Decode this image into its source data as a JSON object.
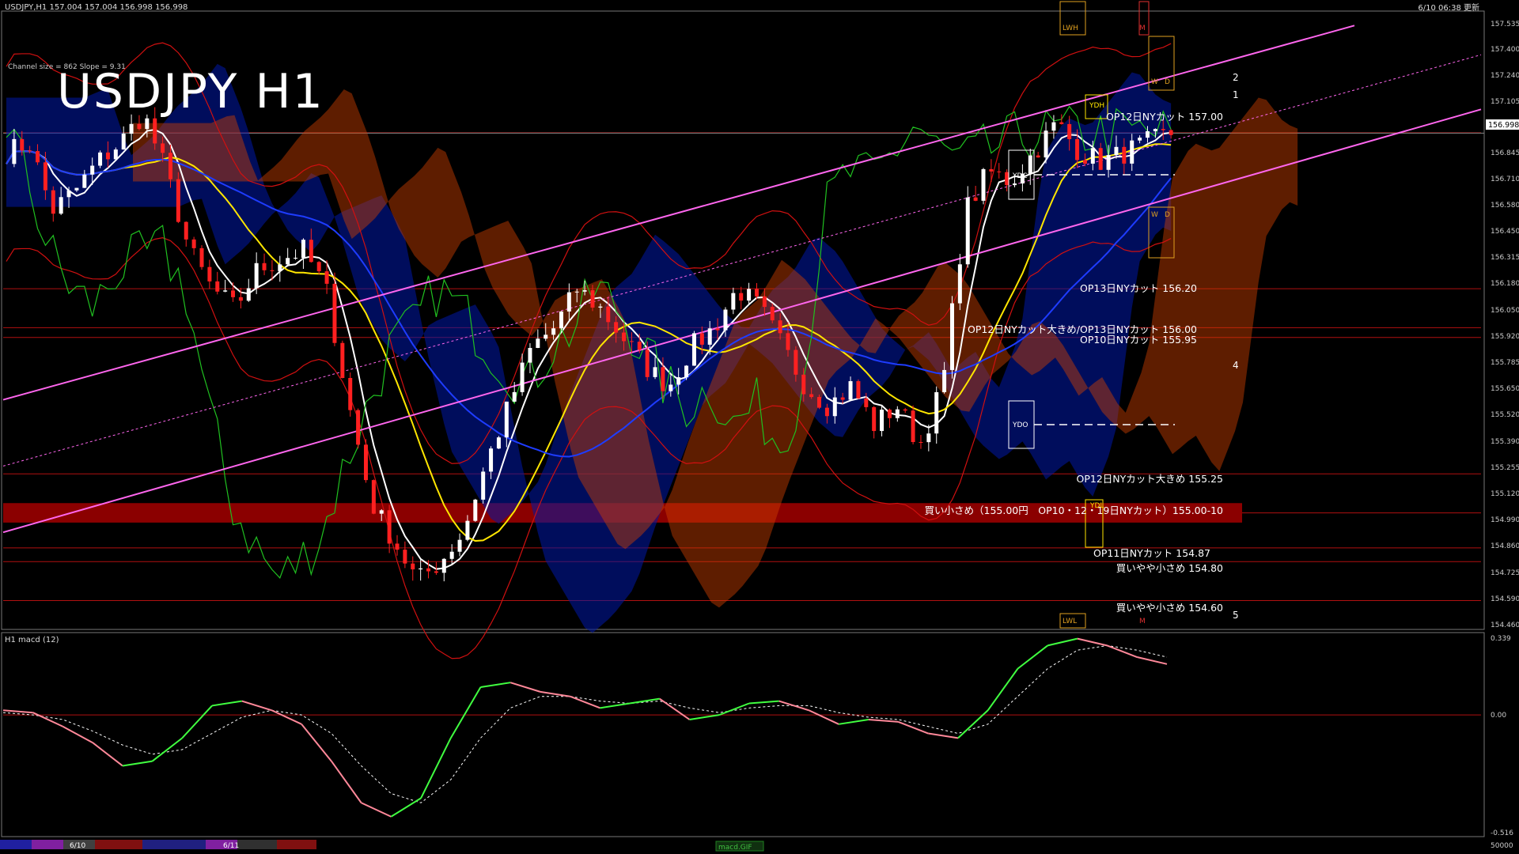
{
  "header": {
    "symbol_line": "USDJPY,H1  157.004 157.004 156.998 156.998",
    "updated": "6/10 06:38 更新",
    "big_title": "USDJPY H1",
    "channel_info": "Channel size = 862 Slope = 9.31"
  },
  "macd_panel": {
    "label": "H1 macd (12)",
    "tab_label": "macd.GIF"
  },
  "price_axis": {
    "ticks": [
      "157.535",
      "157.400",
      "157.240",
      "157.105",
      "156.975",
      "156.845",
      "156.710",
      "156.580",
      "156.450",
      "156.315",
      "156.180",
      "156.050",
      "155.920",
      "155.785",
      "155.650",
      "155.520",
      "155.390",
      "155.255",
      "155.120",
      "154.990",
      "154.860",
      "154.725",
      "154.590",
      "154.460"
    ],
    "current": "156.998"
  },
  "macd_axis": {
    "ticks": [
      "0.339",
      "0.00",
      "-0.516",
      "50000"
    ]
  },
  "date_tabs": [
    "6/10",
    "6/11"
  ],
  "zone_labels": [
    "LWH",
    "M",
    "W",
    "D",
    "YDH",
    "YDC",
    "W",
    "D",
    "YDO",
    "YDL",
    "LWL",
    "M"
  ],
  "wave_labels": [
    "2",
    "1",
    "4",
    "5"
  ],
  "annotations": [
    {
      "text": "OP12日NYカット 157.00",
      "color": "#ffffff"
    },
    {
      "text": "OP13日NYカット 156.20",
      "color": "#ffffff"
    },
    {
      "text": "OP12日NYカット大きめ/OP13日NYカット 156.00",
      "color": "#ffffff"
    },
    {
      "text": "OP10日NYカット 155.95",
      "color": "#ffffff"
    },
    {
      "text": "OP12日NYカット大きめ 155.25",
      "color": "#ffffff"
    },
    {
      "text": "買い小さめ（155.00円　OP10・12・19日NYカット）155.00-10",
      "color": "#ffffff"
    },
    {
      "text": "OP11日NYカット 154.87",
      "color": "#ffffff"
    },
    {
      "text": "買いやや小さめ 154.80",
      "color": "#ffffff"
    },
    {
      "text": "買いやや小さめ 154.60",
      "color": "#ffffff"
    }
  ],
  "colors": {
    "price_up": "#ffffff",
    "price_down": "#ff2020",
    "ma_fast": "#ffffff",
    "ma_mid": "#ffe600",
    "ma_slow": "#1e3cff",
    "bollinger": "#d01010",
    "cloud_a": "#0018a8",
    "cloud_b": "#d04000",
    "channel": "#ff66ee",
    "chikou": "#20c020",
    "macd_up": "#40ff40",
    "macd_down": "#ff8899",
    "zone_band": "#8b0000"
  },
  "chart_data": {
    "type": "candlestick",
    "instrument": "USDJPY",
    "timeframe": "H1",
    "ylim": [
      154.46,
      157.6
    ],
    "close_series": [
      156.9,
      156.95,
      156.6,
      156.7,
      156.85,
      156.95,
      157.1,
      156.8,
      156.4,
      156.2,
      156.1,
      156.3,
      156.35,
      156.4,
      156.2,
      155.6,
      155.1,
      154.9,
      154.7,
      154.8,
      154.95,
      155.3,
      155.6,
      155.9,
      156.0,
      156.2,
      156.1,
      155.95,
      155.8,
      155.7,
      155.9,
      156.0,
      156.2,
      156.1,
      155.9,
      155.7,
      155.6,
      155.7,
      155.5,
      155.6,
      155.4,
      155.7,
      156.6,
      156.8,
      156.75,
      156.9,
      157.05,
      156.9,
      156.85,
      156.9,
      156.95,
      156.998
    ],
    "support_resistance": [
      157.0,
      156.2,
      156.0,
      155.95,
      155.25,
      155.05,
      154.87,
      154.8,
      154.6
    ],
    "macd": {
      "ylim": [
        -0.516,
        0.339
      ],
      "values": [
        0.02,
        0.01,
        -0.05,
        -0.12,
        -0.22,
        -0.2,
        -0.1,
        0.04,
        0.06,
        0.02,
        -0.04,
        -0.2,
        -0.38,
        -0.44,
        -0.36,
        -0.1,
        0.12,
        0.14,
        0.1,
        0.08,
        0.03,
        0.05,
        0.07,
        -0.02,
        0.0,
        0.05,
        0.06,
        0.02,
        -0.04,
        -0.02,
        -0.03,
        -0.08,
        -0.1,
        0.02,
        0.2,
        0.3,
        0.33,
        0.3,
        0.25,
        0.22
      ],
      "signal": [
        0.01,
        0.0,
        -0.02,
        -0.07,
        -0.13,
        -0.17,
        -0.15,
        -0.08,
        -0.01,
        0.02,
        0.0,
        -0.08,
        -0.22,
        -0.34,
        -0.38,
        -0.28,
        -0.1,
        0.03,
        0.08,
        0.08,
        0.06,
        0.05,
        0.06,
        0.03,
        0.01,
        0.03,
        0.04,
        0.04,
        0.01,
        -0.01,
        -0.02,
        -0.05,
        -0.08,
        -0.04,
        0.08,
        0.2,
        0.28,
        0.3,
        0.28,
        0.25
      ]
    }
  }
}
